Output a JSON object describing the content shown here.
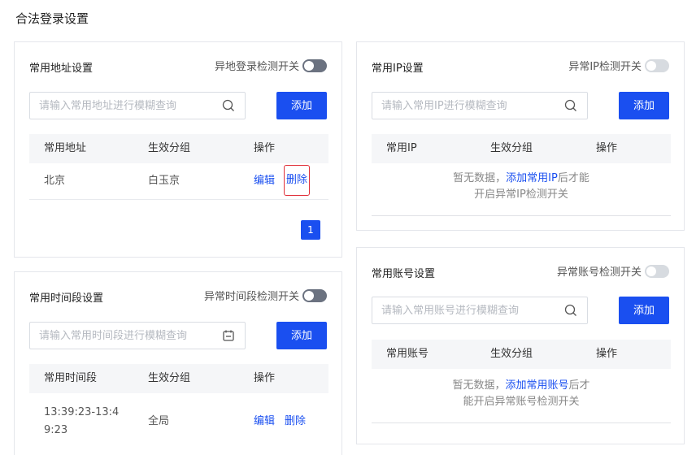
{
  "page_title": "合法登录设置",
  "address_card": {
    "title": "常用地址设置",
    "switch_label": "异地登录检测开关",
    "switch_state": "on",
    "search_placeholder": "请输入常用地址进行模糊查询",
    "search_icon": "search-icon",
    "add_label": "添加",
    "headers": [
      "常用地址",
      "生效分组",
      "操作"
    ],
    "rows": [
      {
        "address": "北京",
        "group": "白玉京",
        "edit": "编辑",
        "delete": "删除"
      }
    ],
    "page": "1"
  },
  "ip_card": {
    "title": "常用IP设置",
    "switch_label": "异常IP检测开关",
    "switch_state": "off",
    "search_placeholder": "请输入常用IP进行模糊查询",
    "search_icon": "search-icon",
    "add_label": "添加",
    "headers": [
      "常用IP",
      "生效分组",
      "操作"
    ],
    "empty_prefix": "暂无数据，",
    "empty_link": "添加常用IP",
    "empty_suffix": "后才能",
    "empty_line2": "开启异常IP检测开关"
  },
  "time_card": {
    "title": "常用时间段设置",
    "switch_label": "异常时间段检测开关",
    "switch_state": "on",
    "search_placeholder": "请输入常用时间段进行模糊查询",
    "search_icon": "calendar-icon",
    "add_label": "添加",
    "headers": [
      "常用时间段",
      "生效分组",
      "操作"
    ],
    "rows": [
      {
        "time_line1": "13:39:23-13:4",
        "time_line2": "9:23",
        "group": "全局",
        "edit": "编辑",
        "delete": "删除"
      }
    ]
  },
  "account_card": {
    "title": "常用账号设置",
    "switch_label": "异常账号检测开关",
    "switch_state": "off",
    "search_placeholder": "请输入常用账号进行模糊查询",
    "search_icon": "search-icon",
    "add_label": "添加",
    "headers": [
      "常用账号",
      "生效分组",
      "操作"
    ],
    "empty_prefix": "暂无数据，",
    "empty_link": "添加常用账号",
    "empty_suffix": "后才",
    "empty_line2": "能开启异常账号检测开关"
  },
  "colors": {
    "primary": "#1a4ff0",
    "highlight": "#e0303a",
    "switch_on": "#6b7280",
    "switch_off": "#d7dbe0"
  }
}
